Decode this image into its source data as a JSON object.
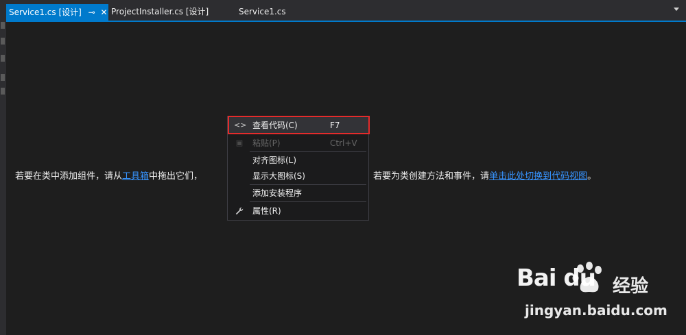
{
  "tabs": [
    {
      "label": "Service1.cs [设计]",
      "active": true,
      "pin_icon": "pin-icon",
      "close_icon": "close-icon"
    },
    {
      "label": "ProjectInstaller.cs [设计]",
      "active": false
    },
    {
      "label": "Service1.cs",
      "active": false
    }
  ],
  "designer": {
    "message_before": "若要在类中添加组件，请从",
    "message_link1": "工具箱",
    "message_middle": "中拖出它们，",
    "message_after": "们的属性。若要为类创建方法和事件，请",
    "message_link2": "单击此处切换到代码视图",
    "message_end": "。"
  },
  "context_menu": {
    "items": [
      {
        "icon": "code-brackets-icon",
        "label": "查看代码(C)",
        "shortcut": "F7",
        "enabled": true,
        "highlighted": true
      },
      {
        "icon": "paste-icon",
        "label": "粘贴(P)",
        "shortcut": "Ctrl+V",
        "enabled": false
      },
      {
        "icon": "",
        "label": "对齐图标(L)",
        "shortcut": "",
        "enabled": true
      },
      {
        "icon": "",
        "label": "显示大图标(S)",
        "shortcut": "",
        "enabled": true
      },
      {
        "icon": "",
        "label": "添加安装程序",
        "shortcut": "",
        "enabled": true
      },
      {
        "icon": "wrench-icon",
        "label": "属性(R)",
        "shortcut": "",
        "enabled": true
      }
    ]
  },
  "watermark": {
    "brand": "Bai du",
    "cn": "经验",
    "url": "jingyan.baidu.com"
  },
  "colors": {
    "accent": "#007acc",
    "highlight_border": "#e52b2b",
    "link": "#3794ff",
    "background": "#1e1e1e"
  }
}
